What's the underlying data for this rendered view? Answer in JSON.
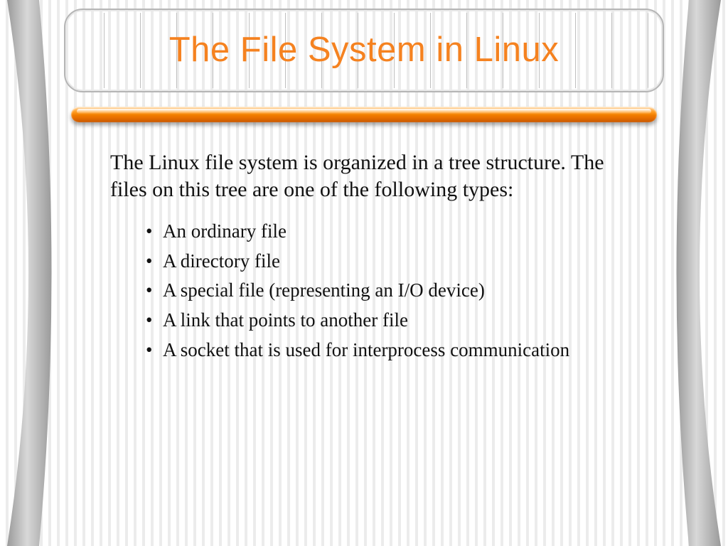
{
  "title": "The File System in Linux",
  "intro": "The Linux file system is organized in a tree structure. The files on this tree are one of the following types:",
  "bullets": [
    "An ordinary file",
    "A directory file",
    "A special file (representing an I/O device)",
    "A link that points to another file",
    "A socket that is used for interprocess communication"
  ],
  "colors": {
    "accent": "#f58220",
    "grey": "#bcbcbc"
  }
}
